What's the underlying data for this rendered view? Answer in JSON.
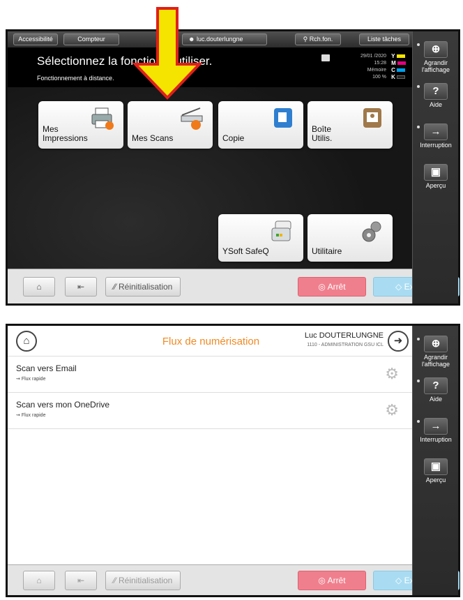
{
  "panel1": {
    "topbar": {
      "accessibility": "Accessibilité",
      "counter": "Compteur",
      "user": "luc.douterlungne",
      "search": "Rch.fon.",
      "jobs": "Liste tâches"
    },
    "header": {
      "title": "Sélectionnez la fonction à utiliser.",
      "subtitle": "Fonctionnement à distance.",
      "date": "29/01 /2020",
      "time": "15:28",
      "memory_label": "Mémoire",
      "memory_value": "100 %",
      "toner_letters": [
        "Y",
        "M",
        "C",
        "K"
      ]
    },
    "tiles": [
      {
        "label": "Mes Impressions",
        "icon": "printer-icon"
      },
      {
        "label": "Mes Scans",
        "icon": "scanner-icon"
      },
      {
        "label": "Copie",
        "icon": "copy-icon"
      },
      {
        "label": "Boîte Utilis.",
        "icon": "user-box-icon"
      },
      {
        "label": "YSoft SafeQ",
        "icon": "safeq-icon"
      },
      {
        "label": "Utilitaire",
        "icon": "gears-icon"
      }
    ],
    "bottom": {
      "reset": "Réinitialisation",
      "stop": "Arrêt",
      "start": "Exécuter"
    }
  },
  "sidebar": {
    "zoom": "Agrandir l'affichage",
    "help": "Aide",
    "interrupt": "Interruption",
    "preview": "Aperçu"
  },
  "panel2": {
    "header": {
      "title": "Flux de numérisation",
      "user": "Luc DOUTERLUNGNE",
      "org": "1110 - ADMINISTRATION GSU ICL"
    },
    "flows": [
      {
        "title": "Scan vers Email",
        "tag": "Flux rapide"
      },
      {
        "title": "Scan vers mon OneDrive",
        "tag": "Flux rapide"
      }
    ],
    "bottom": {
      "reset": "Réinitialisation",
      "stop": "Arrêt",
      "start": "Exécuter"
    }
  },
  "colors": {
    "arrow_fill": "#f5e400",
    "arrow_stroke": "#e0201b",
    "flow_title": "#f08a24",
    "stop_button": "#f07f8d",
    "start_button": "#a9dcf2"
  }
}
